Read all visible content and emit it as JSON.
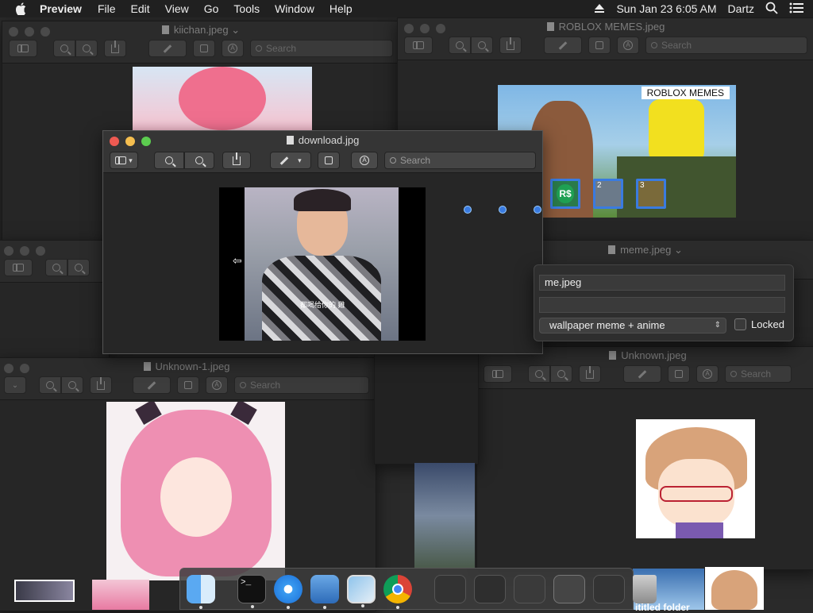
{
  "menubar": {
    "app_name": "Preview",
    "items": [
      "File",
      "Edit",
      "View",
      "Go",
      "Tools",
      "Window",
      "Help"
    ],
    "clock": "Sun Jan 23  6:05 AM",
    "user": "Dartz"
  },
  "windows": {
    "kiichan": {
      "title": "kiichan.jpeg"
    },
    "roblox": {
      "title": "ROBLOX MEMES.jpeg",
      "image_caption": "ROBLOX MEMES",
      "badges": [
        "R$",
        "2",
        "3"
      ]
    },
    "download": {
      "title": "download.jpg",
      "search_placeholder": "Search",
      "subtitle": "都喝给你的 雞"
    },
    "meme": {
      "title": "meme.jpeg"
    },
    "unknown1": {
      "title": "Unknown-1.jpeg",
      "search_placeholder": "Search"
    },
    "unknown": {
      "title": "Unknown.jpeg",
      "search_placeholder": "Search"
    },
    "roblox_search": {
      "search_placeholder": "Search"
    },
    "kiichan_search": {
      "search_placeholder": "Search"
    }
  },
  "popover": {
    "name_value": "me.jpeg",
    "tags_value": "wallpaper meme + anime",
    "locked_label": "Locked"
  },
  "desktop": {
    "folder_label": "ititled folder"
  },
  "colors": {
    "accent_blue": "#3a7be0",
    "menubar_bg": "#202020",
    "window_bg": "#262626"
  }
}
